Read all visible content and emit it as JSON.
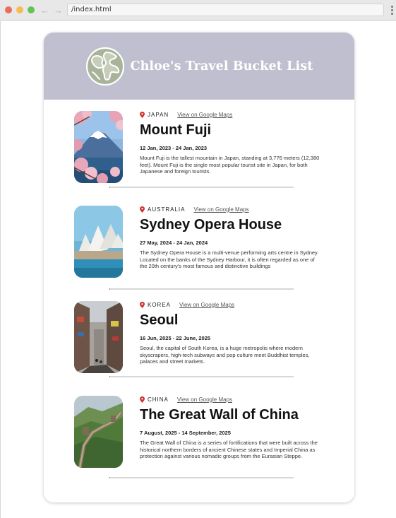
{
  "browser": {
    "url": "/index.html"
  },
  "site": {
    "title": "Chloe's Travel Bucket List",
    "logo_icon": "globe-icon"
  },
  "destinations": [
    {
      "country": "JAPAN",
      "link": "View on Google Maps",
      "name": "Mount Fuji",
      "dates": "12 Jan, 2023 - 24 Jan, 2023",
      "description": "Mount Fuji is the tallest mountain in Japan, standing at 3,776 meters (12,380 feet). Mount Fuji is the single most popular tourist site in Japan, for both Japanese and foreign tourists."
    },
    {
      "country": "AUSTRALIA",
      "link": "View on Google Maps",
      "name": "Sydney Opera House",
      "dates": "27 May, 2024 - 24 Jan, 2024",
      "description": "The Sydney Opera House is a multi-venue performing arts centre in Sydney. Located on the banks of the Sydney Harbour, it is often regarded as one of the 20th century's most famous and distinctive buildings"
    },
    {
      "country": "KOREA",
      "link": "View on Google Maps",
      "name": "Seoul",
      "dates": "16 Jun, 2025 - 22 June, 2025",
      "description": "Seoul, the capital of South Korea, is a huge metropolis where modern skyscrapers, high-tech subways and pop culture meet Buddhist temples, palaces and street markets."
    },
    {
      "country": "CHINA",
      "link": "View on Google Maps",
      "name": "The Great Wall of China",
      "dates": "7 August, 2025 - 14 September, 2025",
      "description": "The Great Wall of China is a series of fortifications that were built across the historical northern borders of ancient Chinese states and Imperial China as protection against various nomadic groups from the Eurasian Steppe."
    }
  ],
  "colors": {
    "header_bg": "#c0bfcf",
    "pin": "#d0312d"
  }
}
